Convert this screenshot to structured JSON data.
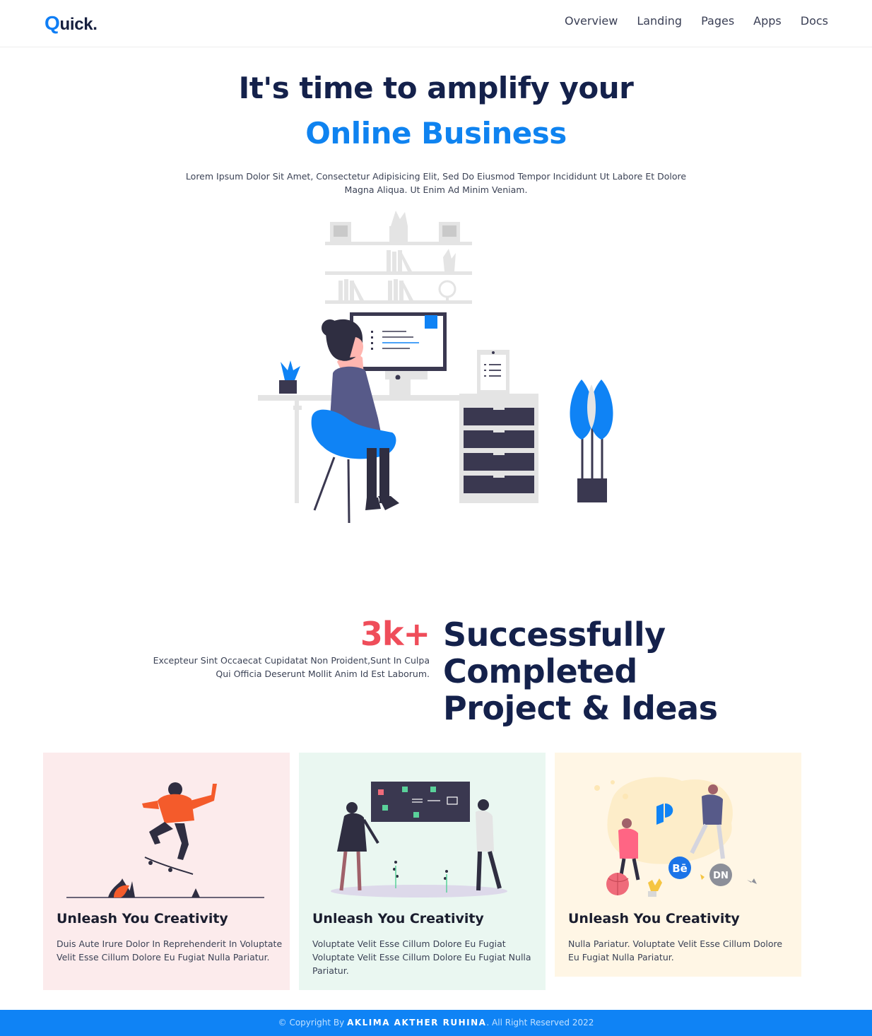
{
  "header": {
    "logo_first_letter": "Q",
    "logo_rest": "uick.",
    "nav": [
      "Overview",
      "Landing",
      "Pages",
      "Apps",
      "Docs"
    ]
  },
  "hero": {
    "title_line1": "It's time to amplify your",
    "title_line2": "Online Business",
    "description": "Lorem Ipsum Dolor Sit Amet, Consectetur Adipisicing Elit, Sed Do Eiusmod Tempor Incididunt Ut Labore Et Dolore Magna Aliqua. Ut Enim Ad Minim Veniam."
  },
  "stats": {
    "description": "Excepteur Sint Occaecat Cupidatat Non Proident,Sunt In Culpa Qui Officia Deserunt Mollit Anim Id Est Laborum.",
    "number": "3k+",
    "title": "Successfully Completed Project & Ideas"
  },
  "cards": [
    {
      "title": "Unleash You Creativity",
      "text": "Duis Aute Irure Dolor In Reprehenderit In Voluptate Velit Esse Cillum Dolore Eu Fugiat Nulla Pariatur."
    },
    {
      "title": "Unleash You Creativity",
      "text": "Voluptate Velit Esse Cillum Dolore Eu Fugiat Voluptate Velit Esse Cillum Dolore Eu Fugiat Nulla Pariatur."
    },
    {
      "title": "Unleash You Creativity",
      "text": "Nulla Pariatur. Voluptate Velit Esse Cillum Dolore Eu Fugiat Nulla Pariatur."
    }
  ],
  "card_icons": {
    "behance": "Bē",
    "dribbble_alt": "DN"
  },
  "footer": {
    "prefix": "© Copyright By",
    "author": "AKLIMA AKTHER RUHINA",
    "suffix": ". All Right Reserved 2022"
  },
  "colors": {
    "brand_blue": "#0f83f0",
    "navy": "#14214b",
    "accent_red": "#ef4d5a",
    "card_pink": "#fcebec",
    "card_mint": "#eaf7f1",
    "card_cream": "#fff6e5"
  }
}
